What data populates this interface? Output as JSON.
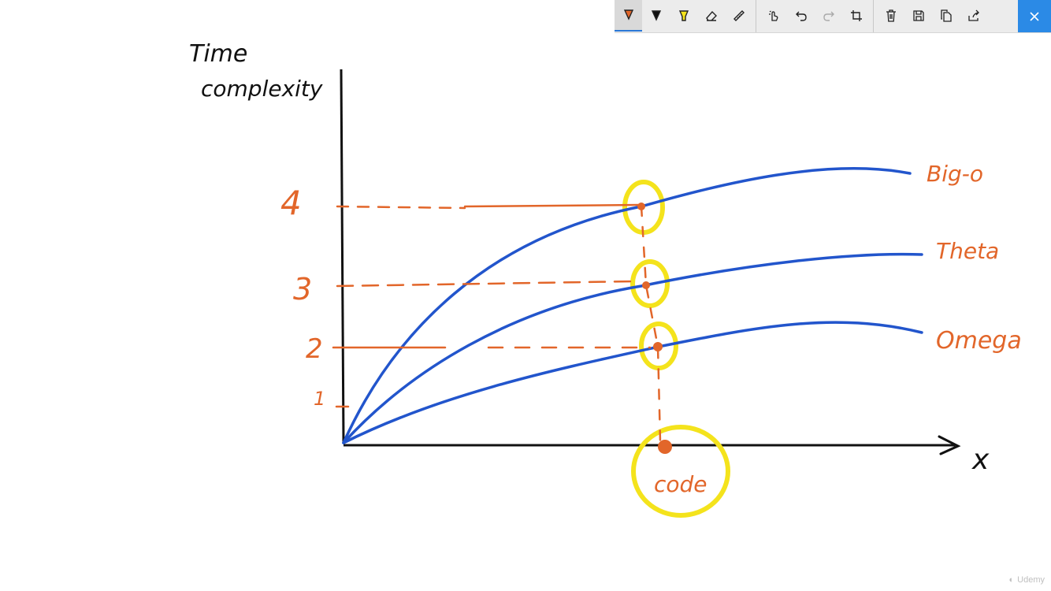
{
  "drawing": {
    "ylabel_line1": "Time",
    "ylabel_line2": "complexity",
    "xlabel": "x",
    "ticks": {
      "t1": "1",
      "t2": "2",
      "t3": "3",
      "t4": "4"
    },
    "curves": {
      "top": "Big-o",
      "middle": "Theta",
      "bottom": "Omega"
    },
    "point_label": "code"
  },
  "toolbar": {
    "buttons": [
      {
        "name": "ballpoint-pen-icon",
        "active": true
      },
      {
        "name": "pencil-icon"
      },
      {
        "name": "highlighter-icon"
      },
      {
        "name": "eraser-icon"
      },
      {
        "name": "ruler-icon"
      },
      {
        "name": "touch-writing-icon"
      },
      {
        "name": "undo-icon"
      },
      {
        "name": "redo-icon"
      },
      {
        "name": "crop-icon"
      },
      {
        "name": "delete-icon"
      },
      {
        "name": "save-icon"
      },
      {
        "name": "copy-icon"
      },
      {
        "name": "share-icon"
      },
      {
        "name": "close-icon"
      }
    ]
  },
  "colors": {
    "blue": "#2255cc",
    "orange": "#e2662a",
    "yellow": "#f4e31c",
    "accent": "#2b8ae6"
  },
  "watermark": "Udemy"
}
